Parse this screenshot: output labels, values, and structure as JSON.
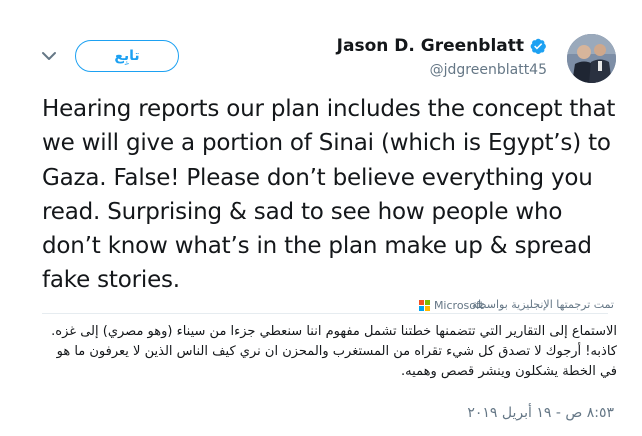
{
  "author": {
    "display_name": "Jason D. Greenblatt",
    "handle": "@jdgreenblatt45",
    "verified": true
  },
  "follow_button_label": "تابِع",
  "tweet_text": "Hearing reports our plan includes the concept that we will give a portion of Sinai (which is Egypt’s) to Gaza. False! Please don’t believe everything you read. Surprising & sad to see how people who don’t know what’s in the plan make up & spread fake stories.",
  "translation": {
    "attribution": "تمت ترجمتها الإنجليزية بواسطة",
    "provider": "Microsoft",
    "text": "الاستماع إلى التقارير التي تتضمنها خطتنا تشمل مفهوم اننا سنعطي جزءا من سيناء (وهو مصري) إلى غزه. كاذبه! أرجوك لا تصدق كل شيء تقراه من المستغرب والمحزن ان نري كيف الناس الذين لا يعرفون ما هو في الخطة يشكلون وينشر قصص وهميه."
  },
  "timestamp": "٨:٥٣ ص - ١٩ أبريل ٢٠١٩",
  "colors": {
    "accent": "#1da1f2",
    "text": "#14171a",
    "secondary_text": "#657786"
  }
}
